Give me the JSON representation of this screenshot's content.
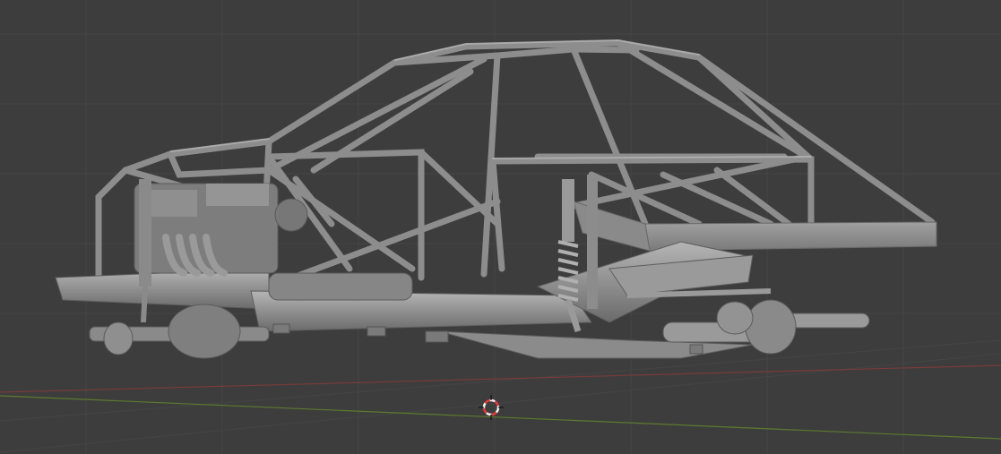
{
  "viewport": {
    "background": "#3d3d3d",
    "grid_color": "#454545",
    "axis_x_color": "#7a3b3b",
    "axis_y_color": "#5e7a2e"
  },
  "model": {
    "color_tube": "#8d8d8d",
    "color_tube_dark": "#5f5f5f",
    "color_highlight": "#b9b9b9"
  },
  "cursor": {
    "icon": "3d-cursor-icon",
    "ring_red": "#e23a3a",
    "ring_white": "#f2f2f2"
  }
}
